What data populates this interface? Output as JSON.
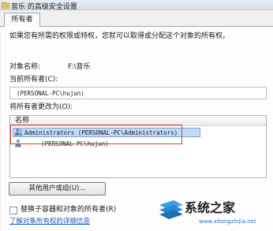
{
  "window": {
    "title": "音乐 的高级安全设置"
  },
  "tabs": [
    {
      "label": "所有者"
    }
  ],
  "description": "如果您有所需的权限或特权，您就可以取得或分配这个对象的所有权。",
  "object": {
    "label": "对象名称:",
    "value": "F:\\音乐"
  },
  "current_owner": {
    "label": "当前所有者(C):",
    "value": "(PERSONAL-PC\\hujun)"
  },
  "change_owner": {
    "label": "将所有者更改为(O):",
    "column_header": "名称",
    "items": [
      {
        "name": "Administrators (PERSONAL-PC\\Administrators)"
      },
      {
        "name": "(PERSONAL-PC\\hujun)"
      }
    ]
  },
  "buttons": {
    "other_users": "其他用户或组(U)..."
  },
  "checkbox": {
    "label": "替换子容器和对象的所有者(R)"
  },
  "link": {
    "text": "了解对象所有权的详细信息"
  },
  "watermark": {
    "brand": "系统之家",
    "url": "www.xitongzhijia.net"
  },
  "colors": {
    "highlight_border": "#d23a3a",
    "selection": "#c2dcf5",
    "link": "#1b5fb5"
  }
}
